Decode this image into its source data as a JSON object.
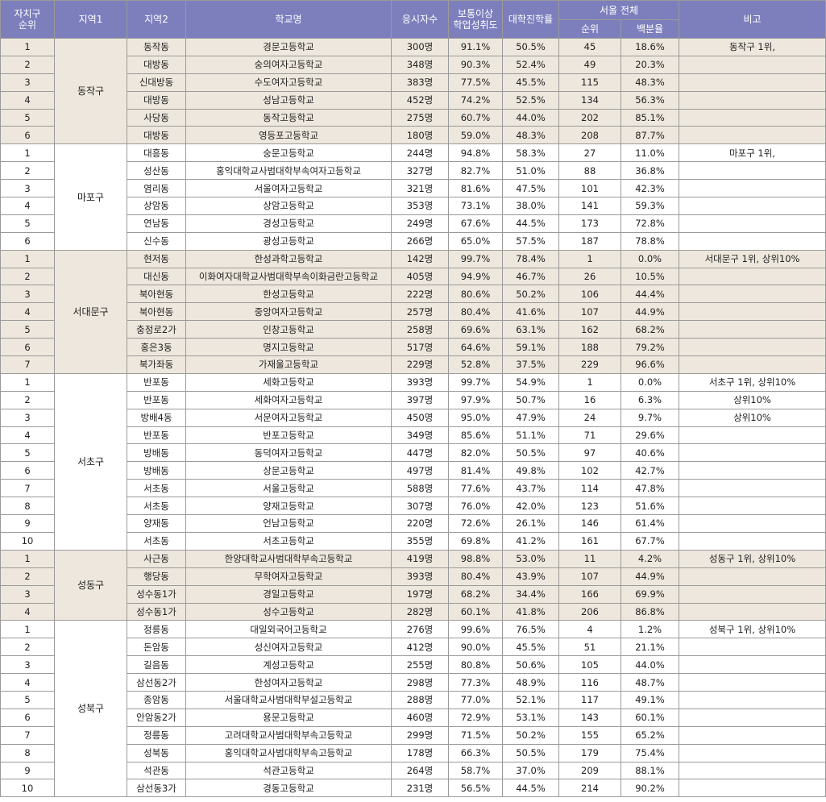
{
  "header": {
    "rank_local": "자치구\n순위",
    "region1": "지역1",
    "region2": "지역2",
    "school": "학교명",
    "applicants": "응시자수",
    "proficiency": "보통이상\n학업성취도",
    "college_rate": "대학진학률",
    "seoul_total": "서울 전체",
    "seoul_rank": "순위",
    "seoul_percent": "백분율",
    "note": "비고"
  },
  "groups": [
    {
      "district": "동작구",
      "shade": true,
      "rows": [
        {
          "rank": "1",
          "dong": "동작동",
          "school": "경문고등학교",
          "applicants": "300명",
          "proficiency": "91.1%",
          "college": "50.5%",
          "seoul_rank": "45",
          "percent": "18.6%",
          "note": "동작구 1위,"
        },
        {
          "rank": "2",
          "dong": "대방동",
          "school": "숭의여자고등학교",
          "applicants": "348명",
          "proficiency": "90.3%",
          "college": "52.4%",
          "seoul_rank": "49",
          "percent": "20.3%",
          "note": ""
        },
        {
          "rank": "3",
          "dong": "신대방동",
          "school": "수도여자고등학교",
          "applicants": "383명",
          "proficiency": "77.5%",
          "college": "45.5%",
          "seoul_rank": "115",
          "percent": "48.3%",
          "note": ""
        },
        {
          "rank": "4",
          "dong": "대방동",
          "school": "성남고등학교",
          "applicants": "452명",
          "proficiency": "74.2%",
          "college": "52.5%",
          "seoul_rank": "134",
          "percent": "56.3%",
          "note": ""
        },
        {
          "rank": "5",
          "dong": "사당동",
          "school": "동작고등학교",
          "applicants": "275명",
          "proficiency": "60.7%",
          "college": "44.0%",
          "seoul_rank": "202",
          "percent": "85.1%",
          "note": ""
        },
        {
          "rank": "6",
          "dong": "대방동",
          "school": "영등포고등학교",
          "applicants": "180명",
          "proficiency": "59.0%",
          "college": "48.3%",
          "seoul_rank": "208",
          "percent": "87.7%",
          "note": ""
        }
      ]
    },
    {
      "district": "마포구",
      "shade": false,
      "rows": [
        {
          "rank": "1",
          "dong": "대흥동",
          "school": "숭문고등학교",
          "applicants": "244명",
          "proficiency": "94.8%",
          "college": "58.3%",
          "seoul_rank": "27",
          "percent": "11.0%",
          "note": "마포구 1위,"
        },
        {
          "rank": "2",
          "dong": "성산동",
          "school": "홍익대학교사범대학부속여자고등학교",
          "applicants": "327명",
          "proficiency": "82.7%",
          "college": "51.0%",
          "seoul_rank": "88",
          "percent": "36.8%",
          "note": ""
        },
        {
          "rank": "3",
          "dong": "염리동",
          "school": "서울여자고등학교",
          "applicants": "321명",
          "proficiency": "81.6%",
          "college": "47.5%",
          "seoul_rank": "101",
          "percent": "42.3%",
          "note": ""
        },
        {
          "rank": "4",
          "dong": "상암동",
          "school": "상암고등학교",
          "applicants": "353명",
          "proficiency": "73.1%",
          "college": "38.0%",
          "seoul_rank": "141",
          "percent": "59.3%",
          "note": ""
        },
        {
          "rank": "5",
          "dong": "연남동",
          "school": "경성고등학교",
          "applicants": "249명",
          "proficiency": "67.6%",
          "college": "44.5%",
          "seoul_rank": "173",
          "percent": "72.8%",
          "note": ""
        },
        {
          "rank": "6",
          "dong": "신수동",
          "school": "광성고등학교",
          "applicants": "266명",
          "proficiency": "65.0%",
          "college": "57.5%",
          "seoul_rank": "187",
          "percent": "78.8%",
          "note": ""
        }
      ]
    },
    {
      "district": "서대문구",
      "shade": true,
      "rows": [
        {
          "rank": "1",
          "dong": "현저동",
          "school": "한성과학고등학교",
          "applicants": "142명",
          "proficiency": "99.7%",
          "college": "78.4%",
          "seoul_rank": "1",
          "percent": "0.0%",
          "note": "서대문구 1위, 상위10%"
        },
        {
          "rank": "2",
          "dong": "대신동",
          "school": "이화여자대학교사범대학부속이화금란고등학교",
          "applicants": "405명",
          "proficiency": "94.9%",
          "college": "46.7%",
          "seoul_rank": "26",
          "percent": "10.5%",
          "note": ""
        },
        {
          "rank": "3",
          "dong": "북아현동",
          "school": "한성고등학교",
          "applicants": "222명",
          "proficiency": "80.6%",
          "college": "50.2%",
          "seoul_rank": "106",
          "percent": "44.4%",
          "note": ""
        },
        {
          "rank": "4",
          "dong": "북아현동",
          "school": "중앙여자고등학교",
          "applicants": "257명",
          "proficiency": "80.4%",
          "college": "41.6%",
          "seoul_rank": "107",
          "percent": "44.9%",
          "note": ""
        },
        {
          "rank": "5",
          "dong": "충정로2가",
          "school": "인창고등학교",
          "applicants": "258명",
          "proficiency": "69.6%",
          "college": "63.1%",
          "seoul_rank": "162",
          "percent": "68.2%",
          "note": ""
        },
        {
          "rank": "6",
          "dong": "홍은3동",
          "school": "명지고등학교",
          "applicants": "517명",
          "proficiency": "64.6%",
          "college": "59.1%",
          "seoul_rank": "188",
          "percent": "79.2%",
          "note": ""
        },
        {
          "rank": "7",
          "dong": "북가좌동",
          "school": "가재울고등학교",
          "applicants": "229명",
          "proficiency": "52.8%",
          "college": "37.5%",
          "seoul_rank": "229",
          "percent": "96.6%",
          "note": ""
        }
      ]
    },
    {
      "district": "서초구",
      "shade": false,
      "rows": [
        {
          "rank": "1",
          "dong": "반포동",
          "school": "세화고등학교",
          "applicants": "393명",
          "proficiency": "99.7%",
          "college": "54.9%",
          "seoul_rank": "1",
          "percent": "0.0%",
          "note": "서초구 1위, 상위10%"
        },
        {
          "rank": "2",
          "dong": "반포동",
          "school": "세화여자고등학교",
          "applicants": "397명",
          "proficiency": "97.9%",
          "college": "50.7%",
          "seoul_rank": "16",
          "percent": "6.3%",
          "note": "상위10%"
        },
        {
          "rank": "3",
          "dong": "방배4동",
          "school": "서문여자고등학교",
          "applicants": "450명",
          "proficiency": "95.0%",
          "college": "47.9%",
          "seoul_rank": "24",
          "percent": "9.7%",
          "note": "상위10%"
        },
        {
          "rank": "4",
          "dong": "반포동",
          "school": "반포고등학교",
          "applicants": "349명",
          "proficiency": "85.6%",
          "college": "51.1%",
          "seoul_rank": "71",
          "percent": "29.6%",
          "note": ""
        },
        {
          "rank": "5",
          "dong": "방배동",
          "school": "동덕여자고등학교",
          "applicants": "447명",
          "proficiency": "82.0%",
          "college": "50.5%",
          "seoul_rank": "97",
          "percent": "40.6%",
          "note": ""
        },
        {
          "rank": "6",
          "dong": "방배동",
          "school": "상문고등학교",
          "applicants": "497명",
          "proficiency": "81.4%",
          "college": "49.8%",
          "seoul_rank": "102",
          "percent": "42.7%",
          "note": ""
        },
        {
          "rank": "7",
          "dong": "서초동",
          "school": "서울고등학교",
          "applicants": "588명",
          "proficiency": "77.6%",
          "college": "43.7%",
          "seoul_rank": "114",
          "percent": "47.8%",
          "note": ""
        },
        {
          "rank": "8",
          "dong": "서초동",
          "school": "양재고등학교",
          "applicants": "307명",
          "proficiency": "76.0%",
          "college": "42.0%",
          "seoul_rank": "123",
          "percent": "51.6%",
          "note": ""
        },
        {
          "rank": "9",
          "dong": "양재동",
          "school": "언남고등학교",
          "applicants": "220명",
          "proficiency": "72.6%",
          "college": "26.1%",
          "seoul_rank": "146",
          "percent": "61.4%",
          "note": ""
        },
        {
          "rank": "10",
          "dong": "서초동",
          "school": "서초고등학교",
          "applicants": "355명",
          "proficiency": "69.8%",
          "college": "41.2%",
          "seoul_rank": "161",
          "percent": "67.7%",
          "note": ""
        }
      ]
    },
    {
      "district": "성동구",
      "shade": true,
      "rows": [
        {
          "rank": "1",
          "dong": "사근동",
          "school": "한양대학교사범대학부속고등학교",
          "applicants": "419명",
          "proficiency": "98.8%",
          "college": "53.0%",
          "seoul_rank": "11",
          "percent": "4.2%",
          "note": "성동구 1위, 상위10%"
        },
        {
          "rank": "2",
          "dong": "행당동",
          "school": "무학여자고등학교",
          "applicants": "393명",
          "proficiency": "80.4%",
          "college": "43.9%",
          "seoul_rank": "107",
          "percent": "44.9%",
          "note": ""
        },
        {
          "rank": "3",
          "dong": "성수동1가",
          "school": "경일고등학교",
          "applicants": "197명",
          "proficiency": "68.2%",
          "college": "34.4%",
          "seoul_rank": "166",
          "percent": "69.9%",
          "note": ""
        },
        {
          "rank": "4",
          "dong": "성수동1가",
          "school": "성수고등학교",
          "applicants": "282명",
          "proficiency": "60.1%",
          "college": "41.8%",
          "seoul_rank": "206",
          "percent": "86.8%",
          "note": ""
        }
      ]
    },
    {
      "district": "성북구",
      "shade": false,
      "rows": [
        {
          "rank": "1",
          "dong": "정릉동",
          "school": "대일외국어고등학교",
          "applicants": "276명",
          "proficiency": "99.6%",
          "college": "76.5%",
          "seoul_rank": "4",
          "percent": "1.2%",
          "note": "성북구 1위, 상위10%"
        },
        {
          "rank": "2",
          "dong": "돈암동",
          "school": "성신여자고등학교",
          "applicants": "412명",
          "proficiency": "90.0%",
          "college": "45.5%",
          "seoul_rank": "51",
          "percent": "21.1%",
          "note": ""
        },
        {
          "rank": "3",
          "dong": "길음동",
          "school": "계성고등학교",
          "applicants": "255명",
          "proficiency": "80.8%",
          "college": "50.6%",
          "seoul_rank": "105",
          "percent": "44.0%",
          "note": ""
        },
        {
          "rank": "4",
          "dong": "삼선동2가",
          "school": "한성여자고등학교",
          "applicants": "298명",
          "proficiency": "77.3%",
          "college": "48.9%",
          "seoul_rank": "116",
          "percent": "48.7%",
          "note": ""
        },
        {
          "rank": "5",
          "dong": "종암동",
          "school": "서울대학교사범대학부설고등학교",
          "applicants": "288명",
          "proficiency": "77.0%",
          "college": "52.1%",
          "seoul_rank": "117",
          "percent": "49.1%",
          "note": ""
        },
        {
          "rank": "6",
          "dong": "안암동2가",
          "school": "용문고등학교",
          "applicants": "460명",
          "proficiency": "72.9%",
          "college": "53.1%",
          "seoul_rank": "143",
          "percent": "60.1%",
          "note": ""
        },
        {
          "rank": "7",
          "dong": "정릉동",
          "school": "고려대학교사범대학부속고등학교",
          "applicants": "299명",
          "proficiency": "71.5%",
          "college": "50.2%",
          "seoul_rank": "155",
          "percent": "65.2%",
          "note": ""
        },
        {
          "rank": "8",
          "dong": "성북동",
          "school": "홍익대학교사범대학부속고등학교",
          "applicants": "178명",
          "proficiency": "66.3%",
          "college": "50.5%",
          "seoul_rank": "179",
          "percent": "75.4%",
          "note": ""
        },
        {
          "rank": "9",
          "dong": "석관동",
          "school": "석관고등학교",
          "applicants": "264명",
          "proficiency": "58.7%",
          "college": "37.0%",
          "seoul_rank": "209",
          "percent": "88.1%",
          "note": ""
        },
        {
          "rank": "10",
          "dong": "삼선동3가",
          "school": "경동고등학교",
          "applicants": "231명",
          "proficiency": "56.5%",
          "college": "44.5%",
          "seoul_rank": "214",
          "percent": "90.2%",
          "note": ""
        }
      ]
    }
  ]
}
